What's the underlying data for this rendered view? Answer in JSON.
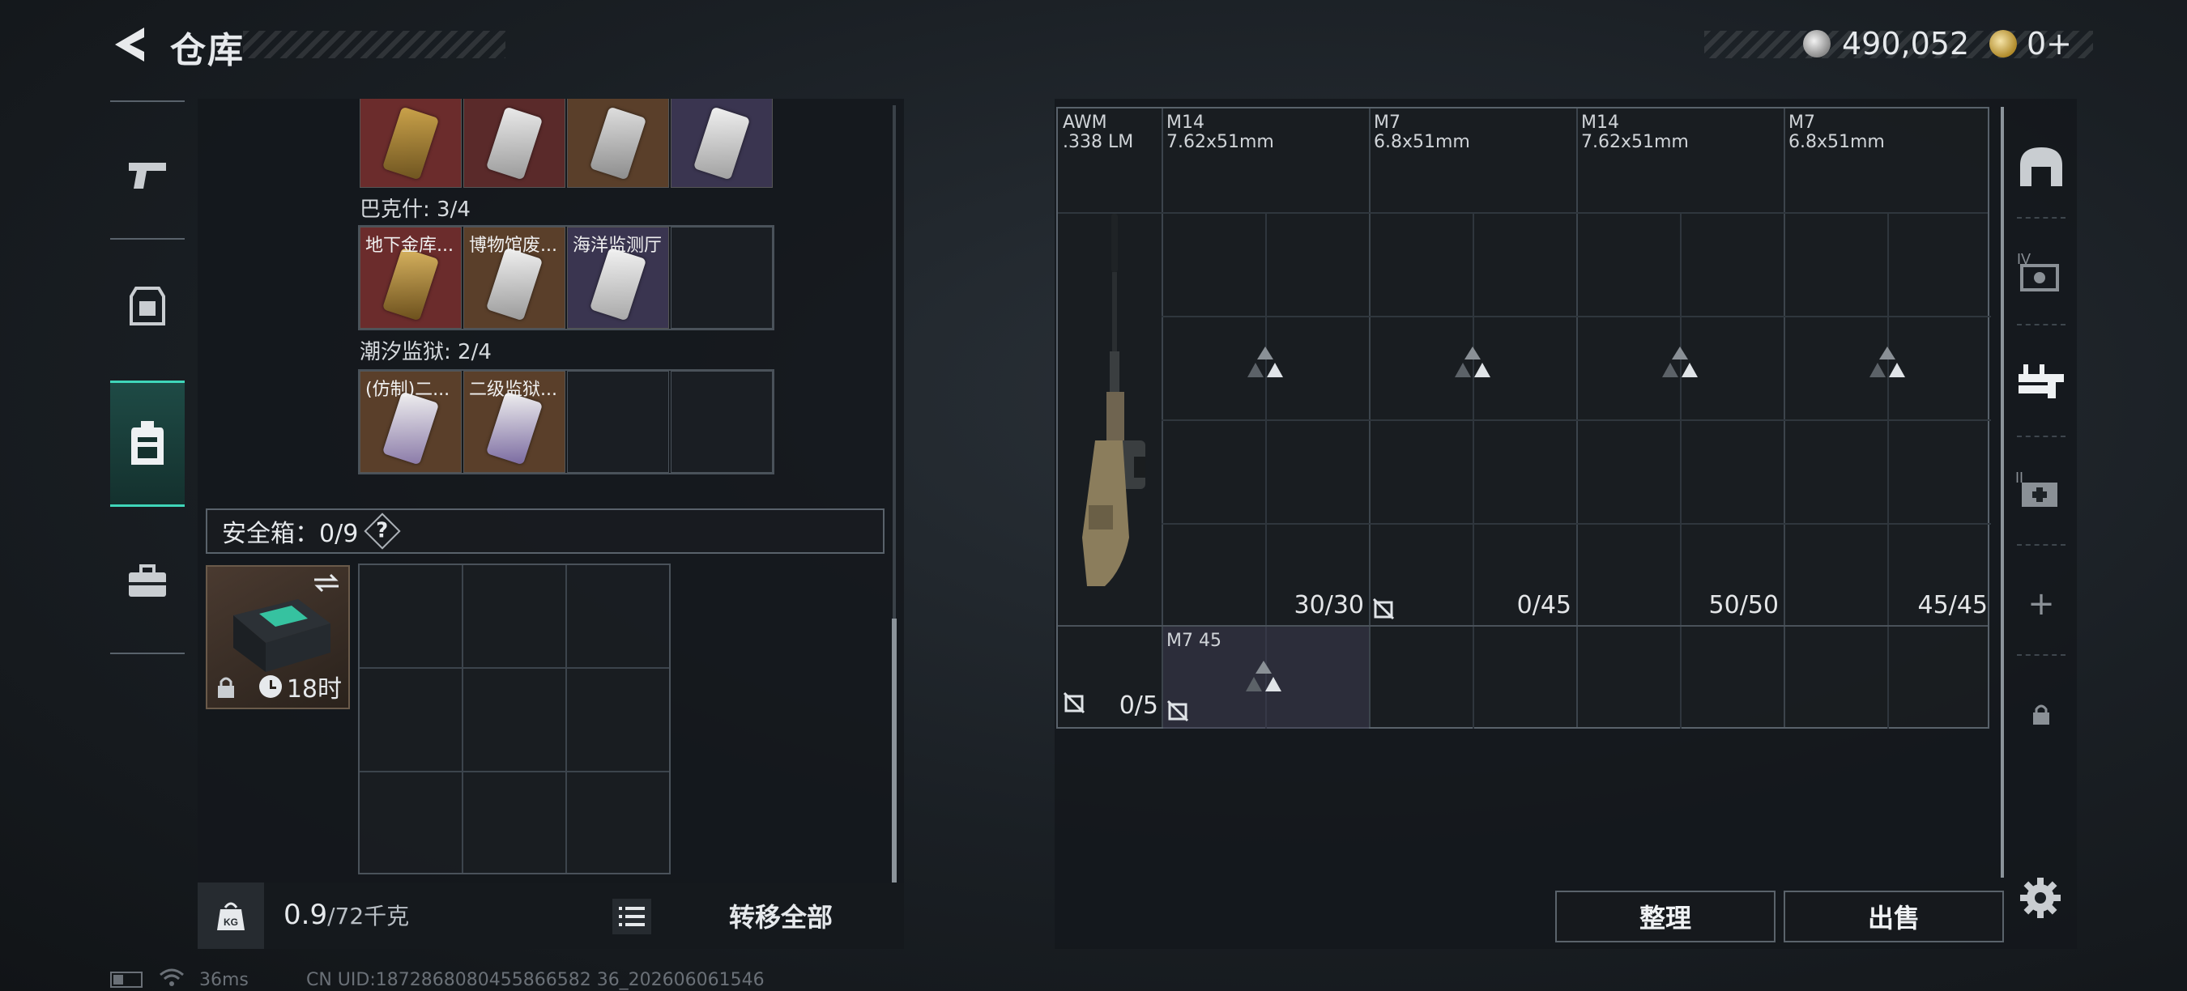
{
  "header": {
    "title": "仓库",
    "currency_silver": "490,052",
    "currency_gold": "0+"
  },
  "left_tabs": [
    {
      "icon": "pistol-icon"
    },
    {
      "icon": "armor-icon"
    },
    {
      "icon": "backpack-icon",
      "active": true
    },
    {
      "icon": "briefcase-icon"
    }
  ],
  "keycards": {
    "row0": [
      {
        "label": "",
        "color": "#6b2c2c"
      },
      {
        "label": "",
        "color": "#5a2a2a"
      },
      {
        "label": "",
        "color": "#5a3f2a"
      },
      {
        "label": "",
        "color": "#3a3550"
      }
    ],
    "group1": {
      "title": "巴克什: 3/4",
      "items": [
        {
          "label": "地下金库...",
          "color": "#6b2c2c"
        },
        {
          "label": "博物馆废...",
          "color": "#5a3f2a"
        },
        {
          "label": "海洋监测厅",
          "color": "#3a3550"
        }
      ]
    },
    "group2": {
      "title": "潮汐监狱: 2/4",
      "items": [
        {
          "label": "(仿制)二...",
          "color": "#5a3f2a"
        },
        {
          "label": "二级监狱...",
          "color": "#5a3f2a"
        }
      ]
    }
  },
  "safe_box": {
    "title": "安全箱：0/9",
    "help": "?",
    "timer": "18时"
  },
  "footer": {
    "weight_value": "0.9",
    "weight_max": "/72千克",
    "transfer_all": "转移全部"
  },
  "weapon": {
    "name": "AWM",
    "caliber": ".338 LM",
    "ammo": "0/5"
  },
  "mags": [
    {
      "name": "M14",
      "caliber": "7.62x51mm",
      "ammo": "30/30"
    },
    {
      "name": "M7",
      "caliber": "6.8x51mm",
      "ammo": "0/45"
    },
    {
      "name": "M14",
      "caliber": "7.62x51mm",
      "ammo": "50/50"
    },
    {
      "name": "M7",
      "caliber": "6.8x51mm",
      "ammo": "45/45"
    }
  ],
  "extra_slot": {
    "label": "M7 45"
  },
  "actions": {
    "sort": "整理",
    "sell": "出售"
  },
  "status_bar": {
    "ping": "36ms",
    "uid": "CN UID:1872868080455866582 36_202606061546"
  }
}
